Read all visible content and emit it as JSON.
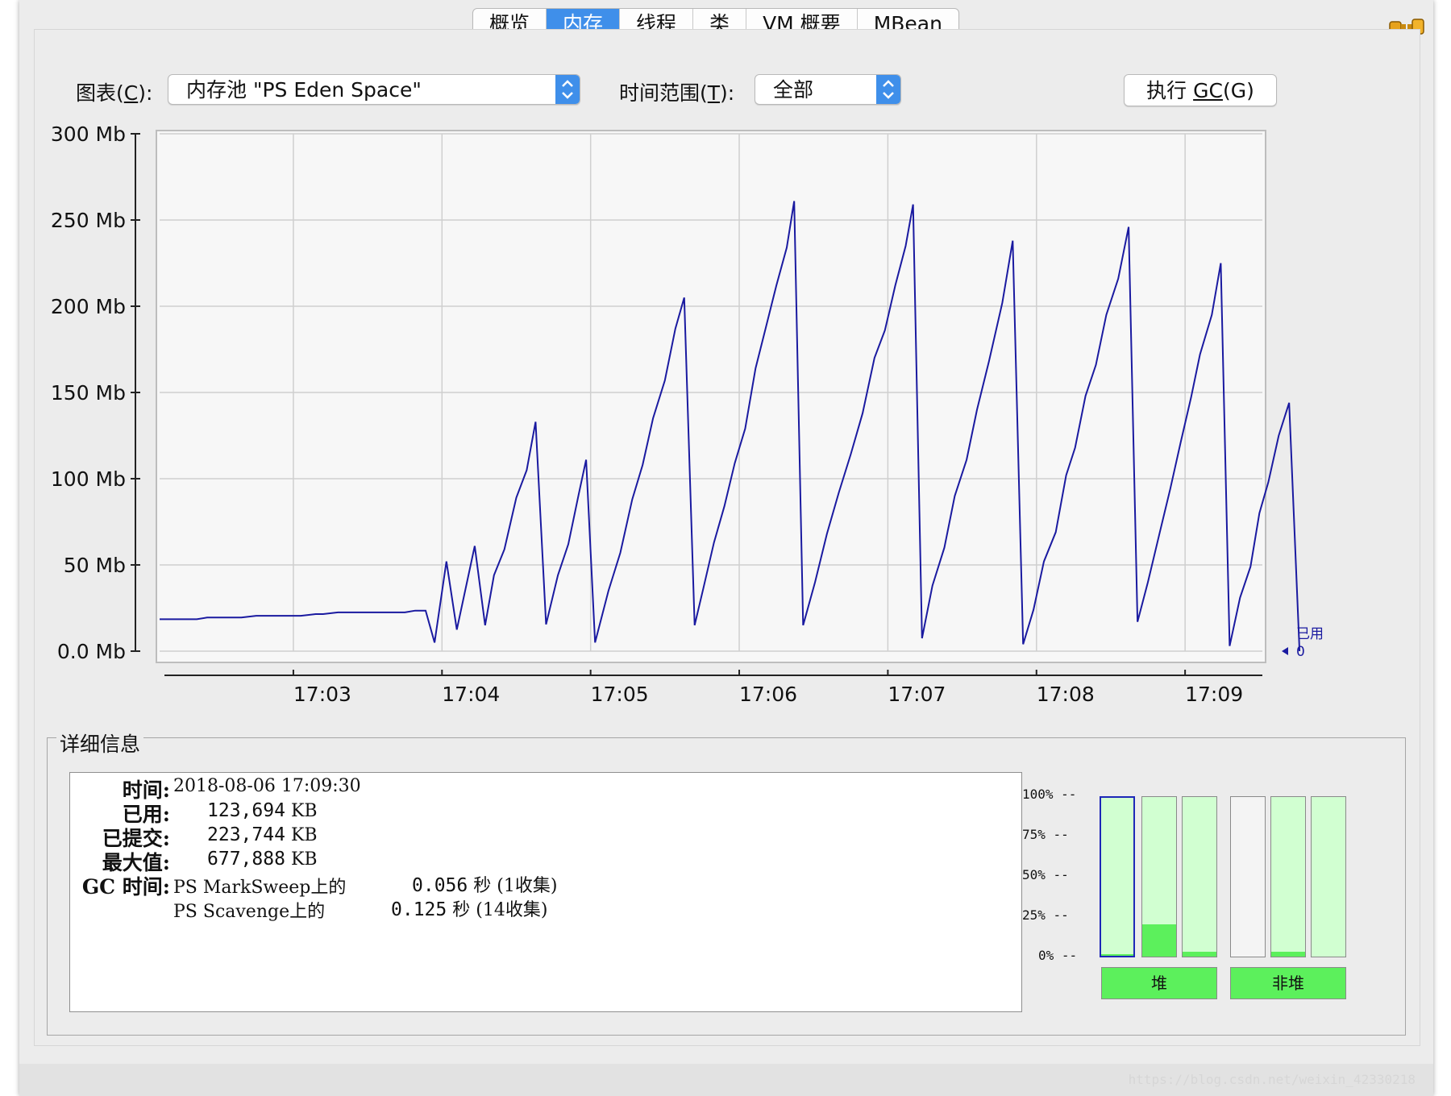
{
  "tabs": [
    "概览",
    "内存",
    "线程",
    "类",
    "VM 概要",
    "MBean"
  ],
  "active_tab_index": 1,
  "chart_control": {
    "label_prefix": "图表(",
    "label_key": "C",
    "label_suffix": "):",
    "value": "内存池 \"PS Eden Space\""
  },
  "time_range": {
    "label_prefix": "时间范围(",
    "label_key": "T",
    "label_suffix": "):",
    "value": "全部"
  },
  "gc_button": {
    "prefix": "执行 ",
    "key_text": "GC",
    "suffix": "(G)"
  },
  "chart_data": {
    "type": "line",
    "y_tick_labels": [
      "300 Mb",
      "250 Mb",
      "200 Mb",
      "150 Mb",
      "100 Mb",
      "50 Mb",
      "0.0 Mb"
    ],
    "y_ticks": [
      300,
      250,
      200,
      150,
      100,
      50,
      0
    ],
    "ylim": [
      0,
      300
    ],
    "x_tick_labels": [
      "17:03",
      "17:04",
      "17:05",
      "17:06",
      "17:07",
      "17:08",
      "17:09"
    ],
    "x_ticks_minutes": [
      3,
      4,
      5,
      6,
      7,
      8,
      9
    ],
    "xlim_minutes": [
      2.1,
      9.52
    ],
    "grid": true,
    "series": [
      {
        "name": "已用",
        "color": "#1a1aa0",
        "points": [
          [
            2.1,
            18.5
          ],
          [
            2.35,
            18.5
          ],
          [
            2.42,
            19.5
          ],
          [
            2.65,
            19.5
          ],
          [
            2.75,
            20.5
          ],
          [
            3.05,
            20.5
          ],
          [
            3.15,
            21.5
          ],
          [
            3.2,
            21.5
          ],
          [
            3.3,
            22.5
          ],
          [
            3.75,
            22.5
          ],
          [
            3.82,
            23.5
          ],
          [
            3.89,
            23.5
          ],
          [
            3.95,
            5
          ],
          [
            4.03,
            52
          ],
          [
            4.1,
            12.5
          ],
          [
            4.22,
            61
          ],
          [
            4.29,
            15
          ],
          [
            4.35,
            44
          ],
          [
            4.42,
            59
          ],
          [
            4.5,
            89
          ],
          [
            4.57,
            105
          ],
          [
            4.63,
            133
          ],
          [
            4.7,
            15.5
          ],
          [
            4.78,
            44
          ],
          [
            4.85,
            62
          ],
          [
            4.92,
            91
          ],
          [
            4.97,
            111
          ],
          [
            5.03,
            5
          ],
          [
            5.12,
            35
          ],
          [
            5.2,
            57
          ],
          [
            5.28,
            88
          ],
          [
            5.35,
            108
          ],
          [
            5.42,
            135
          ],
          [
            5.5,
            157
          ],
          [
            5.57,
            187
          ],
          [
            5.63,
            205
          ],
          [
            5.7,
            15
          ],
          [
            5.76,
            37
          ],
          [
            5.83,
            63
          ],
          [
            5.9,
            84
          ],
          [
            5.97,
            109
          ],
          [
            6.04,
            129
          ],
          [
            6.11,
            164
          ],
          [
            6.18,
            188
          ],
          [
            6.25,
            212
          ],
          [
            6.32,
            234
          ],
          [
            6.37,
            261
          ],
          [
            6.43,
            15
          ],
          [
            6.51,
            40
          ],
          [
            6.59,
            68
          ],
          [
            6.67,
            92
          ],
          [
            6.75,
            114
          ],
          [
            6.83,
            138
          ],
          [
            6.91,
            170
          ],
          [
            6.98,
            186
          ],
          [
            7.05,
            212
          ],
          [
            7.12,
            235
          ],
          [
            7.17,
            259
          ],
          [
            7.23,
            7.5
          ],
          [
            7.3,
            38
          ],
          [
            7.38,
            60
          ],
          [
            7.45,
            90
          ],
          [
            7.53,
            111
          ],
          [
            7.6,
            140
          ],
          [
            7.68,
            168
          ],
          [
            7.77,
            202
          ],
          [
            7.84,
            238
          ],
          [
            7.91,
            4
          ],
          [
            7.98,
            24
          ],
          [
            8.05,
            52
          ],
          [
            8.13,
            69
          ],
          [
            8.2,
            102
          ],
          [
            8.26,
            118
          ],
          [
            8.33,
            148
          ],
          [
            8.4,
            166
          ],
          [
            8.47,
            195
          ],
          [
            8.55,
            216
          ],
          [
            8.62,
            246
          ],
          [
            8.68,
            17
          ],
          [
            8.75,
            40
          ],
          [
            8.83,
            69
          ],
          [
            8.9,
            94
          ],
          [
            8.97,
            121
          ],
          [
            9.04,
            147
          ],
          [
            9.1,
            172
          ],
          [
            9.18,
            195
          ],
          [
            9.24,
            225
          ],
          [
            9.3,
            3
          ],
          [
            9.37,
            31
          ],
          [
            9.44,
            49
          ],
          [
            9.5,
            80
          ],
          [
            9.56,
            98
          ],
          [
            9.63,
            125
          ],
          [
            9.7,
            144
          ],
          [
            9.77,
            0
          ]
        ]
      }
    ],
    "legend": {
      "label": "已用",
      "value": "0",
      "placement": "right"
    }
  },
  "details": {
    "title": "详细信息",
    "rows": [
      {
        "key": "时间:",
        "value": "2018-08-06 17:09:30"
      },
      {
        "key": "已用:",
        "num": "123,694",
        "unit": "KB"
      },
      {
        "key": "已提交:",
        "num": "223,744",
        "unit": "KB"
      },
      {
        "key": "最大值:",
        "num": "677,888",
        "unit": "KB"
      }
    ],
    "gc_key": "GC 时间:",
    "gc_rows": [
      {
        "collector": "PS MarkSweep上的",
        "time": "0.056",
        "sec": "秒",
        "count": "(1收集)"
      },
      {
        "collector": "PS Scavenge上的",
        "time": "0.125",
        "sec": "秒",
        "count": "(14收集)"
      }
    ]
  },
  "usage_bars": {
    "axis_labels": [
      "100% --",
      "75% --",
      "50% --",
      "25% --",
      "0% --"
    ],
    "bars": [
      {
        "fill_fraction": 0.01,
        "selected": true,
        "empty": false
      },
      {
        "fill_fraction": 0.2,
        "selected": false,
        "empty": false
      },
      {
        "fill_fraction": 0.03,
        "selected": false,
        "empty": false
      },
      {
        "fill_fraction": 0.0,
        "selected": false,
        "empty": true
      },
      {
        "fill_fraction": 0.03,
        "selected": false,
        "empty": false
      },
      {
        "fill_fraction": 0.0,
        "selected": false,
        "empty": false
      }
    ],
    "heap_label": "堆",
    "nonheap_label": "非堆"
  },
  "watermark": "https://blog.csdn.net/weixin_42330218"
}
